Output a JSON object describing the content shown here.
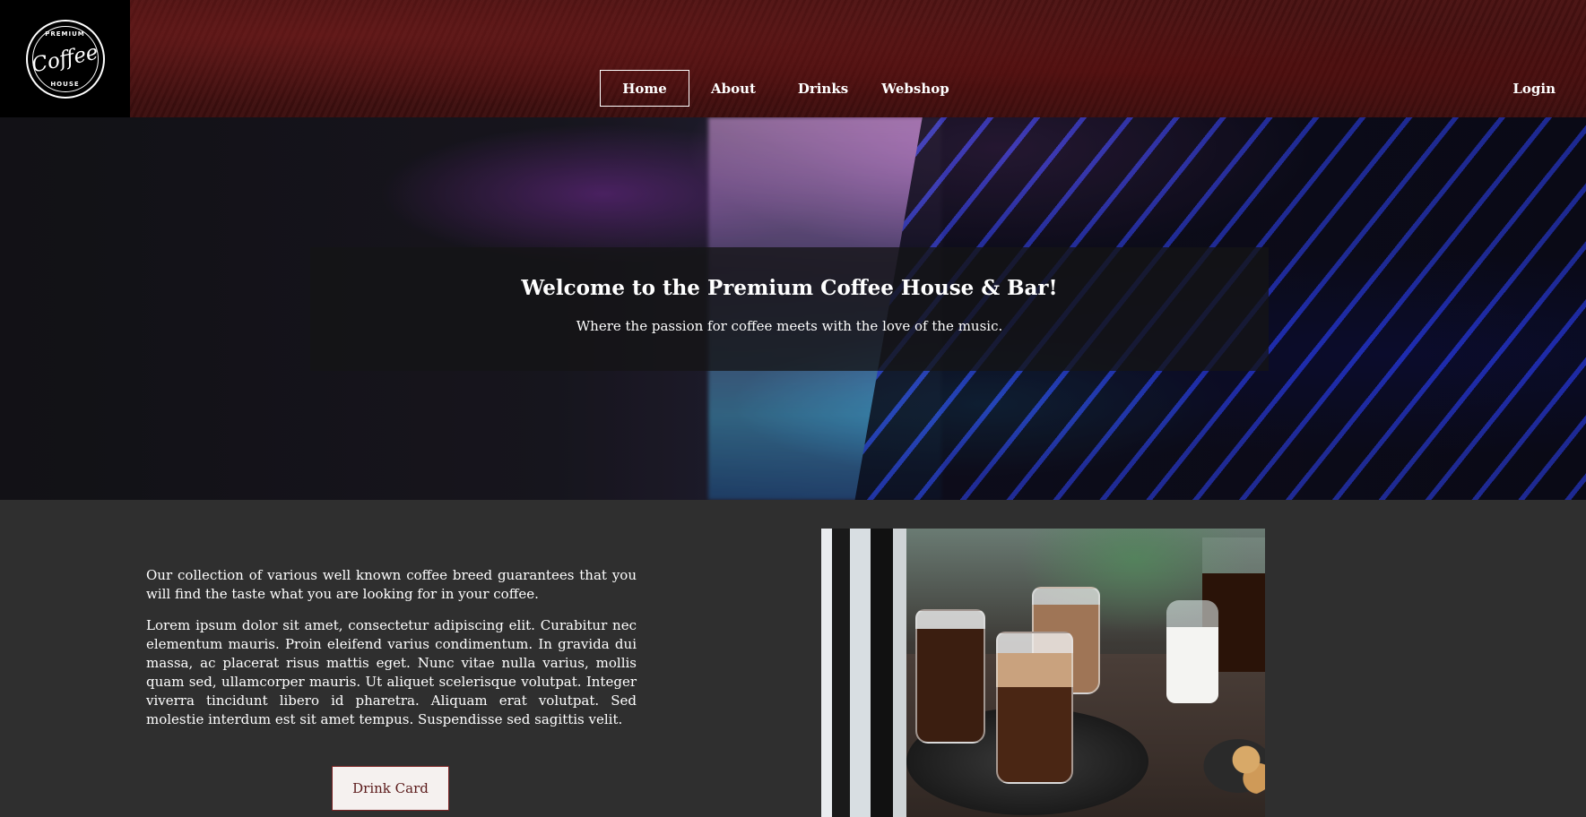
{
  "brand": {
    "logo_top": "PREMIUM",
    "logo_main": "Coffee",
    "logo_bottom": "HOUSE"
  },
  "nav": {
    "items": [
      {
        "label": "Home",
        "active": true
      },
      {
        "label": "About",
        "active": false
      },
      {
        "label": "Drinks",
        "active": false
      },
      {
        "label": "Webshop",
        "active": false
      }
    ],
    "login_label": "Login"
  },
  "hero": {
    "title": "Welcome to the Premium Coffee House & Bar!",
    "subtitle": "Where the passion for coffee meets with the love of the music."
  },
  "intro": {
    "paragraph_1": "Our collection of various well known coffee breed guarantees that you will find the taste what you are looking for in your coffee.",
    "paragraph_2": "Lorem ipsum dolor sit amet, consectetur adipiscing elit. Curabitur nec elementum mauris. Proin eleifend varius condimentum. In gravida dui massa, ac placerat risus mattis eget. Nunc vitae nulla varius, mollis quam sed, ullamcorper mauris. Ut aliquet scelerisque volutpat. Integer viverra tincidunt libero id pharetra. Aliquam erat volutpat. Sed molestie interdum est sit amet tempus. Suspendisse sed sagittis velit.",
    "button_label": "Drink Card"
  },
  "colors": {
    "header_bg": "#3c0e0e",
    "page_bg": "#2f2f2f",
    "button_bg": "#f5f1ef",
    "button_text": "#5a1a1a"
  },
  "icons": {
    "logo": "coffee-house-logo"
  }
}
